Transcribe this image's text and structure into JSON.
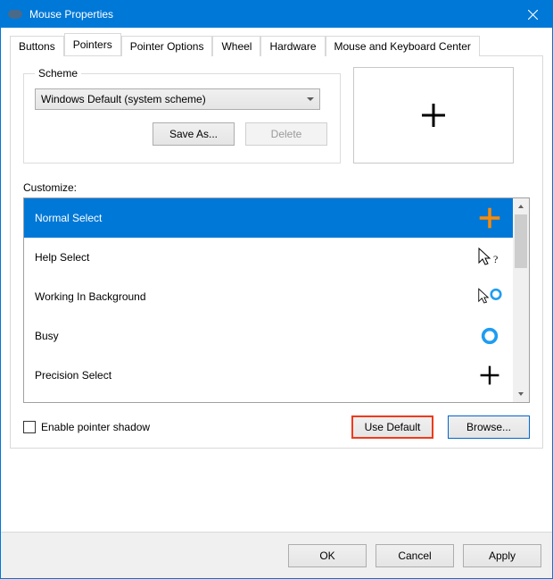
{
  "window": {
    "title": "Mouse Properties"
  },
  "tabs": [
    {
      "label": "Buttons"
    },
    {
      "label": "Pointers"
    },
    {
      "label": "Pointer Options"
    },
    {
      "label": "Wheel"
    },
    {
      "label": "Hardware"
    },
    {
      "label": "Mouse and Keyboard Center"
    }
  ],
  "activeTab": 1,
  "scheme": {
    "legend": "Scheme",
    "selected": "Windows Default (system scheme)",
    "saveAs": "Save As...",
    "delete": "Delete"
  },
  "customize": {
    "label": "Customize:",
    "items": [
      {
        "label": "Normal Select",
        "icon": "plus-orange",
        "selected": true
      },
      {
        "label": "Help Select",
        "icon": "arrow-question",
        "selected": false
      },
      {
        "label": "Working In Background",
        "icon": "arrow-ring",
        "selected": false
      },
      {
        "label": "Busy",
        "icon": "ring",
        "selected": false
      },
      {
        "label": "Precision Select",
        "icon": "plus-black",
        "selected": false
      }
    ]
  },
  "shadow": {
    "label": "Enable pointer shadow",
    "checked": false
  },
  "buttons": {
    "useDefault": "Use Default",
    "browse": "Browse...",
    "ok": "OK",
    "cancel": "Cancel",
    "apply": "Apply"
  }
}
